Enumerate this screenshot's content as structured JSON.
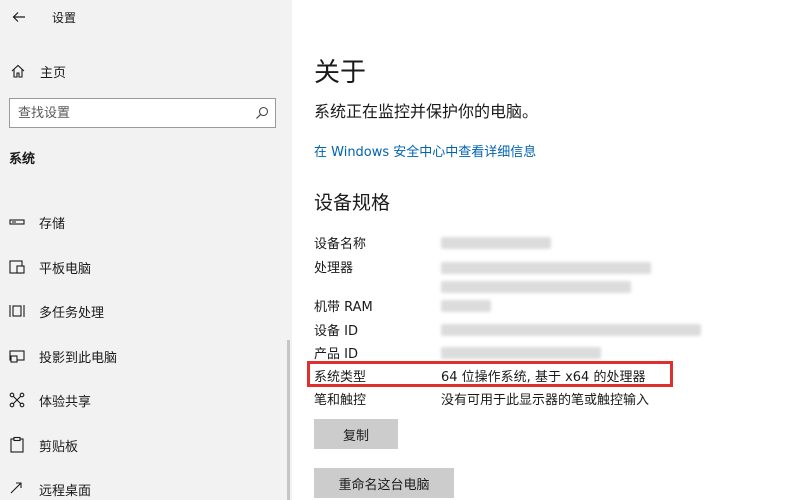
{
  "window": {
    "title": "设置"
  },
  "sidebar": {
    "home_label": "主页",
    "search_placeholder": "查找设置",
    "section": "系统",
    "items": [
      {
        "label": "存储",
        "icon": "storage-icon"
      },
      {
        "label": "平板电脑",
        "icon": "tablet-icon"
      },
      {
        "label": "多任务处理",
        "icon": "multitasking-icon"
      },
      {
        "label": "投影到此电脑",
        "icon": "project-icon"
      },
      {
        "label": "体验共享",
        "icon": "share-icon"
      },
      {
        "label": "剪贴板",
        "icon": "clipboard-icon"
      },
      {
        "label": "远程桌面",
        "icon": "remote-desktop-icon"
      }
    ]
  },
  "main": {
    "title": "关于",
    "protect_text": "系统正在监控并保护你的电脑。",
    "security_link": "在 Windows 安全中心中查看详细信息",
    "spec_heading": "设备规格",
    "specs": {
      "device_name_label": "设备名称",
      "processor_label": "处理器",
      "ram_label": "机带 RAM",
      "device_id_label": "设备 ID",
      "product_id_label": "产品 ID",
      "system_type_label": "系统类型",
      "system_type_value": "64 位操作系统, 基于 x64 的处理器",
      "pen_touch_label": "笔和触控",
      "pen_touch_value": "没有可用于此显示器的笔或触控输入"
    },
    "copy_button": "复制",
    "rename_button": "重命名这台电脑"
  },
  "colors": {
    "link": "#0063b1",
    "highlight": "#e0302e",
    "sidebar_bg": "#f2f2f2",
    "button_bg": "#cccccc"
  }
}
